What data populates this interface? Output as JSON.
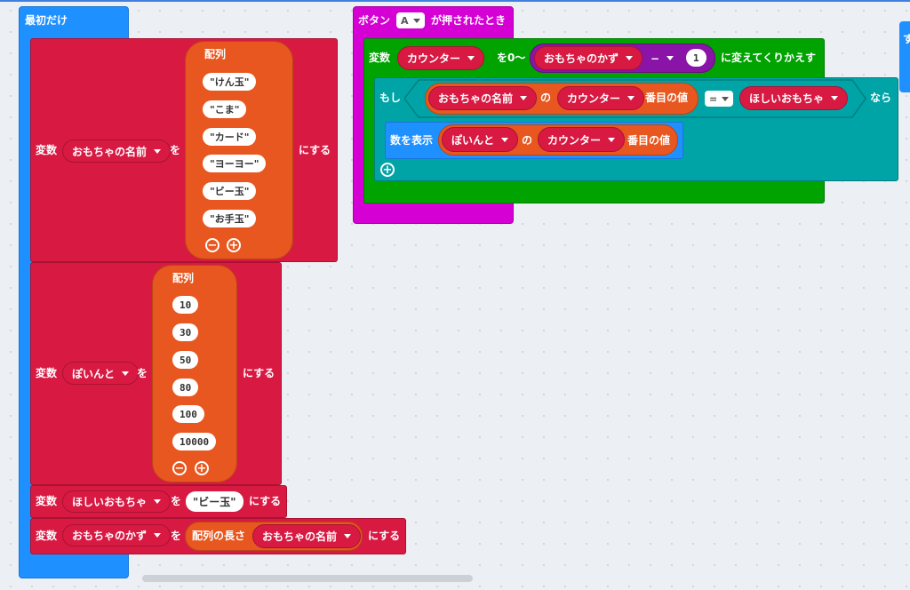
{
  "on_start": {
    "title": "最初だけ",
    "set_toy_names": {
      "keyword": "変数",
      "variable": "おもちゃの名前",
      "to": "を",
      "action": "にする",
      "array_label": "配列",
      "items": [
        "けん玉",
        "こま",
        "カード",
        "ヨーヨー",
        "ビー玉",
        "お手玉"
      ]
    },
    "set_points": {
      "keyword": "変数",
      "variable": "ぽいんと",
      "to": "を",
      "action": "にする",
      "array_label": "配列",
      "items": [
        "10",
        "30",
        "50",
        "80",
        "100",
        "10000"
      ]
    },
    "set_wanted_toy": {
      "keyword": "変数",
      "variable": "ほしいおもちゃ",
      "to": "を",
      "value": "ビー玉",
      "action": "にする"
    },
    "set_toy_count": {
      "keyword": "変数",
      "variable": "おもちゃのかず",
      "to": "を",
      "length_label": "配列の長さ",
      "array_var": "おもちゃの名前",
      "action": "にする"
    }
  },
  "button_event": {
    "label_before": "ボタン",
    "button": "A",
    "label_after": "が押されたとき",
    "loop": {
      "keyword": "変数",
      "variable": "カウンター",
      "range_label": "を0〜",
      "count_var": "おもちゃのかず",
      "operator": "−",
      "operand": "1",
      "suffix": "に変えてくりかえす"
    },
    "if_block": {
      "keyword": "もし",
      "array_var": "おもちゃの名前",
      "of": "の",
      "index_var": "カウンター",
      "index_label": "番目の値",
      "compare": "=",
      "target_var": "ほしいおもちゃ",
      "then": "なら"
    },
    "show_number": {
      "label": "数を表示",
      "array_var": "ぽいんと",
      "of": "の",
      "index_var": "カウンター",
      "index_label": "番目の値"
    }
  },
  "partial_block": {
    "text": "す"
  }
}
